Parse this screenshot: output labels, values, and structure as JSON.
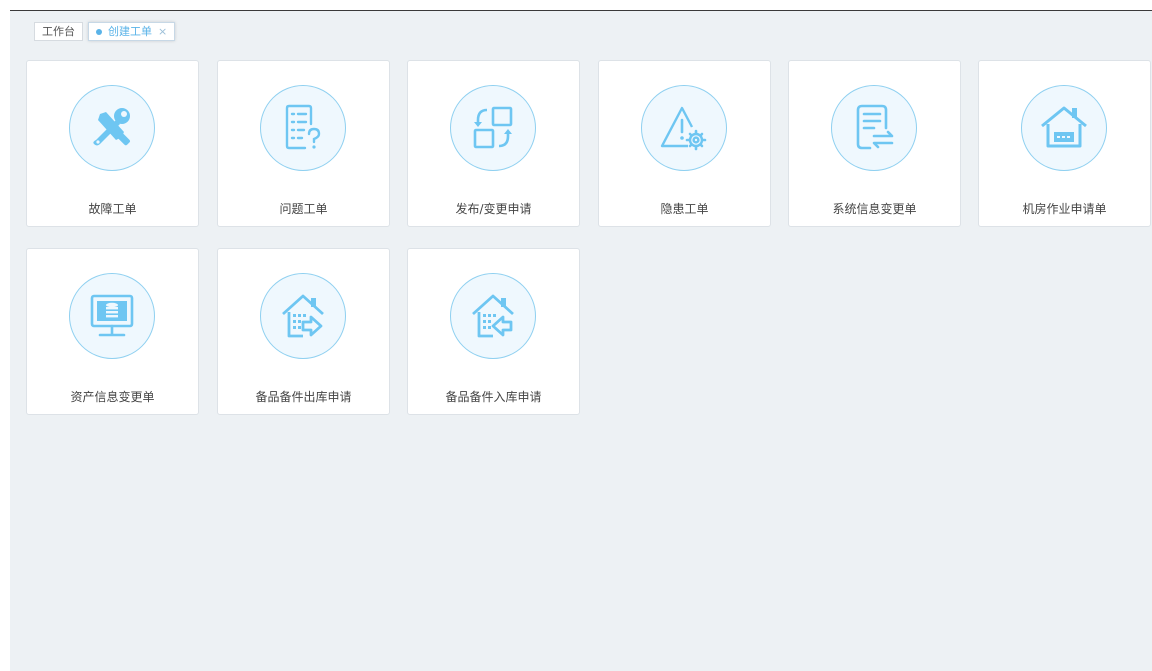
{
  "tabs": [
    {
      "label": "工作台",
      "active": false
    },
    {
      "label": "创建工单",
      "active": true,
      "close": "×"
    }
  ],
  "colors": {
    "accent": "#5ab3e8",
    "icon": "#6ec6f2",
    "workspace_bg": "#edf1f4"
  },
  "cards": [
    {
      "label": "故障工单",
      "icon": "tools-icon"
    },
    {
      "label": "问题工单",
      "icon": "question-list-icon"
    },
    {
      "label": "发布/变更申请",
      "icon": "change-cycle-icon"
    },
    {
      "label": "隐患工单",
      "icon": "warning-gear-icon"
    },
    {
      "label": "系统信息变更单",
      "icon": "doc-exchange-icon"
    },
    {
      "label": "机房作业申请单",
      "icon": "house-server-icon"
    },
    {
      "label": "资产信息变更单",
      "icon": "monitor-database-icon"
    },
    {
      "label": "备品备件出库申请",
      "icon": "warehouse-out-icon"
    },
    {
      "label": "备品备件入库申请",
      "icon": "warehouse-in-icon"
    }
  ]
}
